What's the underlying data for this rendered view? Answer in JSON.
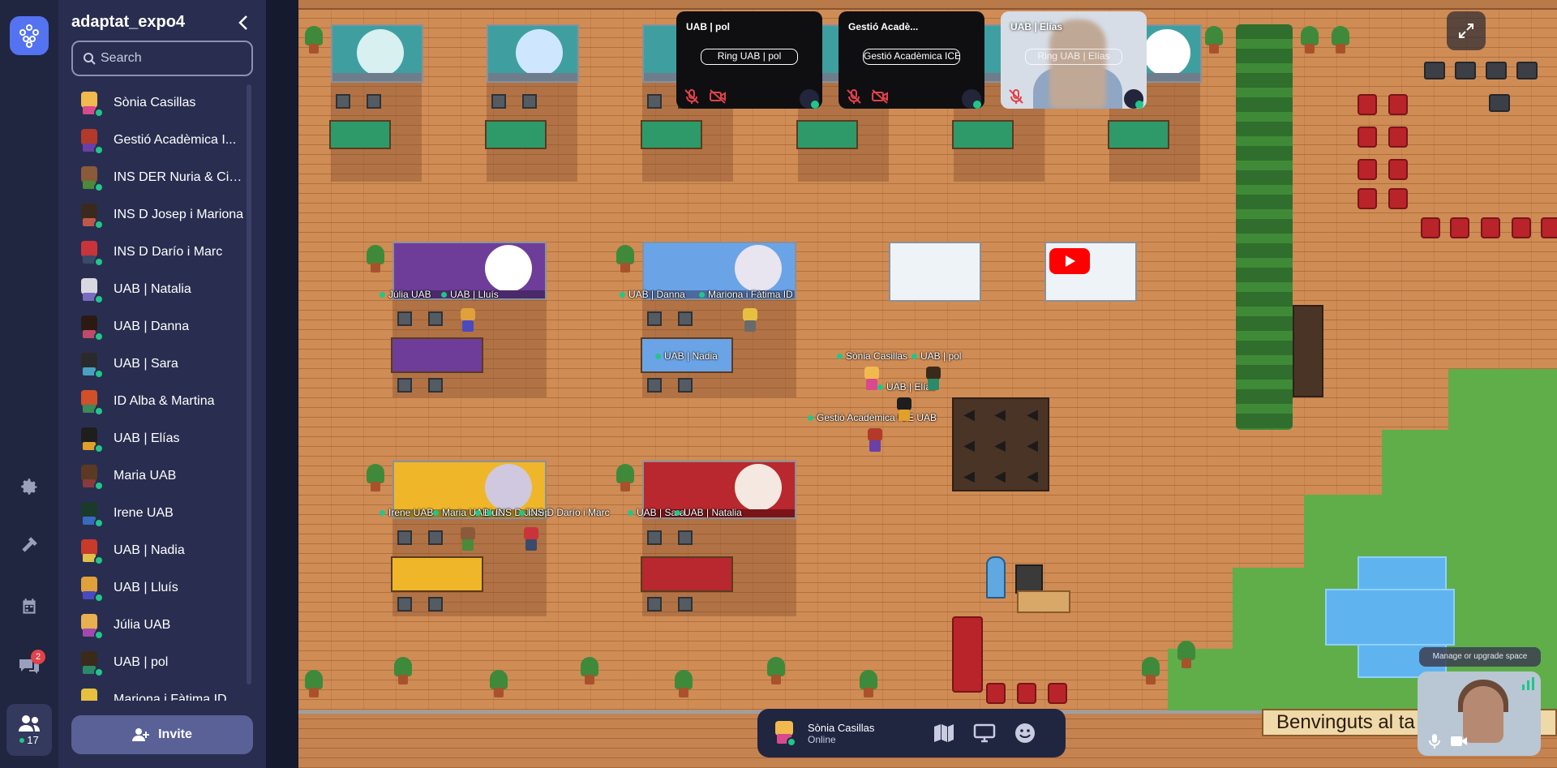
{
  "sidebar": {
    "space_name": "adaptat_expo4",
    "search_placeholder": "Search",
    "invite_label": "Invite",
    "online_count": "17",
    "chat_badge": "2",
    "users": [
      {
        "name": "Sònia Casillas",
        "hair": "#f2b94e",
        "shirt": "#d94a8c"
      },
      {
        "name": "Gestió Acadèmica I...",
        "hair": "#b33a2a",
        "shirt": "#6b3fa8"
      },
      {
        "name": "INS DER Nuria & Cinta",
        "hair": "#8a5a3a",
        "shirt": "#4a8a3a"
      },
      {
        "name": "INS D Josep i Mariona",
        "hair": "#3a2a1e",
        "shirt": "#c0584a"
      },
      {
        "name": "INS D Darío i Marc",
        "hair": "#c8343a",
        "shirt": "#3a4a6a"
      },
      {
        "name": "UAB | Natalia",
        "hair": "#d8d8e0",
        "shirt": "#7a6ac0"
      },
      {
        "name": "UAB | Danna",
        "hair": "#2a1a12",
        "shirt": "#c04a6a"
      },
      {
        "name": "UAB | Sara",
        "hair": "#2a2a2a",
        "shirt": "#4aa0c0"
      },
      {
        "name": "ID Alba & Martina",
        "hair": "#d0502a",
        "shirt": "#3a8a5a"
      },
      {
        "name": "UAB | Elías",
        "hair": "#1e1e1e",
        "shirt": "#e0a02a"
      },
      {
        "name": "Maria UAB",
        "hair": "#5a3a22",
        "shirt": "#8a3a3a"
      },
      {
        "name": "Irene UAB",
        "hair": "#1a3a2a",
        "shirt": "#3a6ac0"
      },
      {
        "name": "UAB | Nadia",
        "hair": "#c83a2a",
        "shirt": "#e0c04a"
      },
      {
        "name": "UAB | Lluís",
        "hair": "#e0a03a",
        "shirt": "#4a4ac0"
      },
      {
        "name": "Júlia UAB",
        "hair": "#e8b050",
        "shirt": "#a04ab0"
      },
      {
        "name": "UAB | pol",
        "hair": "#3a2a1a",
        "shirt": "#2a8a6a"
      },
      {
        "name": "Mariona i Fàtima ID",
        "hair": "#e8c040",
        "shirt": "#6a6a6a"
      }
    ]
  },
  "map": {
    "table_labels": [
      {
        "text": "Júlia UAB",
        "row": "purple"
      },
      {
        "text": "UAB | Lluís",
        "row": "purple"
      },
      {
        "text": "UAB | Danna",
        "row": "blue"
      },
      {
        "text": "Mariona i Fàtima ID",
        "row": "blue"
      },
      {
        "text": "UAB | Nadia",
        "row": "blue-desk"
      },
      {
        "text": "Irene UAB",
        "row": "yellow"
      },
      {
        "text": "Maria UAB",
        "row": "yellow"
      },
      {
        "text": "Lluís",
        "row": "yellow"
      },
      {
        "text": "INS D Josep",
        "row": "yellow"
      },
      {
        "text": "INS D Darío i Marc",
        "row": "yellow"
      },
      {
        "text": "UAB | Sara",
        "row": "red"
      },
      {
        "text": "UAB | Natalia",
        "row": "red"
      }
    ],
    "floor_labels": {
      "sonia": "Sònia Casillas",
      "pol": "UAB | pol",
      "elias": "UAB | Elías",
      "gestio": "Gestió Acadèmica ICE UAB"
    },
    "welcome_sign": "Benvinguts al ta",
    "manage_label": "Manage or upgrade space"
  },
  "video_tiles": [
    {
      "name": "UAB | pol",
      "ring": "Ring UAB | pol"
    },
    {
      "name": "Gestió Acadè...",
      "ring": "Gestió Acadèmica ICE"
    },
    {
      "name": "UAB | Elías",
      "ring": "Ring UAB | Elías"
    }
  ],
  "dock": {
    "name": "Sònia Casillas",
    "status": "Online"
  },
  "colors": {
    "accent": "#5473f0",
    "online": "#21c68a",
    "sidebar_bg": "#292e50",
    "rail_bg": "#202540",
    "badge": "#e2424a"
  }
}
